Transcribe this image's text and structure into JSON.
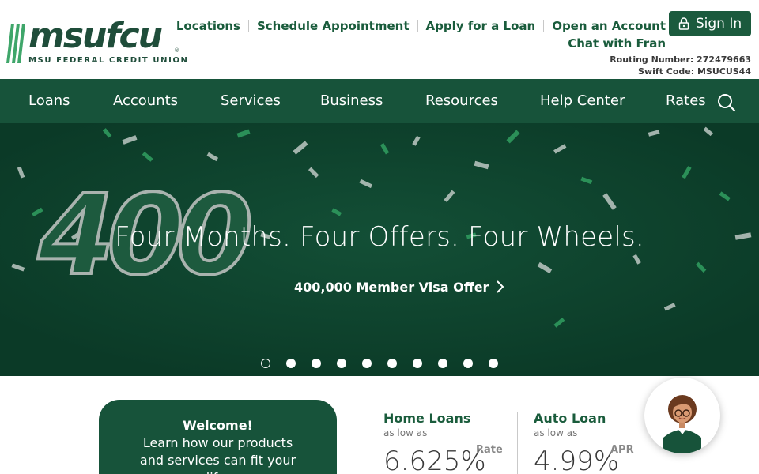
{
  "brand": {
    "name": "msufcu",
    "registered": "®",
    "tagline": "MSU FEDERAL CREDIT UNION",
    "color": "#17533a"
  },
  "utility_links": {
    "row1": [
      "Locations",
      "Schedule Appointment",
      "Apply for a Loan",
      "Open an Account"
    ],
    "row2": [
      "Chat with Fran"
    ]
  },
  "signin": {
    "label": "Sign In",
    "icon": "lock-icon"
  },
  "codes": {
    "routing": "Routing Number: 272479663",
    "swift": "Swift Code: MSUCUS44"
  },
  "nav": {
    "items": [
      "Loans",
      "Accounts",
      "Services",
      "Business",
      "Resources",
      "Help Center",
      "Rates"
    ],
    "search_icon": "search-icon"
  },
  "hero": {
    "graphic_text": "400",
    "headline": "Four Months. Four Offers. Four Wheels.",
    "cta": "400,000 Member Visa Offer",
    "slide_count": 10,
    "active_slide": 1
  },
  "welcome": {
    "title": "Welcome!",
    "body": "Learn how our products and services can fit your life."
  },
  "rates": [
    {
      "title": "Home Loans",
      "sub": "as low as",
      "value": "6.625%",
      "unit": "Rate"
    },
    {
      "title": "Auto Loan",
      "sub": "as low as",
      "value": "4.99%",
      "unit": "APR"
    }
  ],
  "chat": {
    "icon": "chat-assistant-avatar"
  }
}
